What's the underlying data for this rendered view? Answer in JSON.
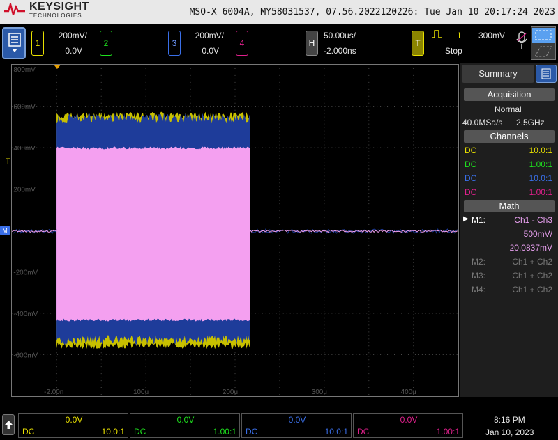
{
  "header": {
    "brand": "KEYSIGHT",
    "brand_sub": "TECHNOLOGIES",
    "device_info": "MSO-X 6004A, MY58031537, 07.56.2022120226: Tue Jan 10 20:17:24 2023"
  },
  "channels": [
    {
      "num": "1",
      "scale": "200mV/",
      "offset": "0.0V",
      "color": "#e8e000"
    },
    {
      "num": "2",
      "scale": "",
      "offset": "",
      "color": "#1ee01e"
    },
    {
      "num": "3",
      "scale": "200mV/",
      "offset": "0.0V",
      "color": "#3a6fe8"
    },
    {
      "num": "4",
      "scale": "",
      "offset": "",
      "color": "#e0208c"
    }
  ],
  "horizontal": {
    "label": "H",
    "timebase": "50.00us/",
    "delay": "-2.000ns"
  },
  "trigger": {
    "label": "T",
    "source": "1",
    "level": "300mV",
    "state": "Stop"
  },
  "grid": {
    "y_labels": [
      "800mV",
      "600mV",
      "400mV",
      "200mV",
      "",
      "-200mV",
      "-400mV",
      "-600mV"
    ],
    "x_labels": [
      "-2.00n",
      "100u",
      "200u",
      "300u",
      "400u"
    ],
    "trigger_marker": "T",
    "ground_marker": "M"
  },
  "panel": {
    "title": "Summary",
    "acquisition_header": "Acquisition",
    "acq_mode": "Normal",
    "sample_rate": "40.0MSa/s",
    "bandwidth": "2.5GHz",
    "channels_header": "Channels",
    "channels": [
      {
        "coupling": "DC",
        "probe": "10.0:1",
        "color": "#e8e000"
      },
      {
        "coupling": "DC",
        "probe": "1.00:1",
        "color": "#1ee01e"
      },
      {
        "coupling": "DC",
        "probe": "10.0:1",
        "color": "#3a6fe8"
      },
      {
        "coupling": "DC",
        "probe": "1.00:1",
        "color": "#e0208c"
      }
    ],
    "math_header": "Math",
    "math": [
      {
        "name": "M1:",
        "expr": "Ch1 - Ch3",
        "active": true
      },
      {
        "name": "",
        "expr": "500mV/",
        "active": true
      },
      {
        "name": "",
        "expr": "20.0837mV",
        "active": true
      },
      {
        "name": "M2:",
        "expr": "Ch1 + Ch2",
        "active": false
      },
      {
        "name": "M3:",
        "expr": "Ch1 + Ch2",
        "active": false
      },
      {
        "name": "M4:",
        "expr": "Ch1 + Ch2",
        "active": false
      }
    ]
  },
  "bottom": {
    "cells": [
      {
        "offset": "0.0V",
        "coupling": "DC",
        "probe": "10.0:1",
        "color": "#e8e000"
      },
      {
        "offset": "0.0V",
        "coupling": "DC",
        "probe": "1.00:1",
        "color": "#1ee01e"
      },
      {
        "offset": "0.0V",
        "coupling": "DC",
        "probe": "10.0:1",
        "color": "#3a6fe8"
      },
      {
        "offset": "0.0V",
        "coupling": "DC",
        "probe": "1.00:1",
        "color": "#e0208c"
      }
    ],
    "time": "8:16 PM",
    "date": "Jan 10, 2023"
  },
  "colors": {
    "math_pink": "#f4a0f0",
    "ch3_blue": "#1e3c9a",
    "ch1_yellow": "#c8c000",
    "panel_text": "#d0d0d0"
  }
}
